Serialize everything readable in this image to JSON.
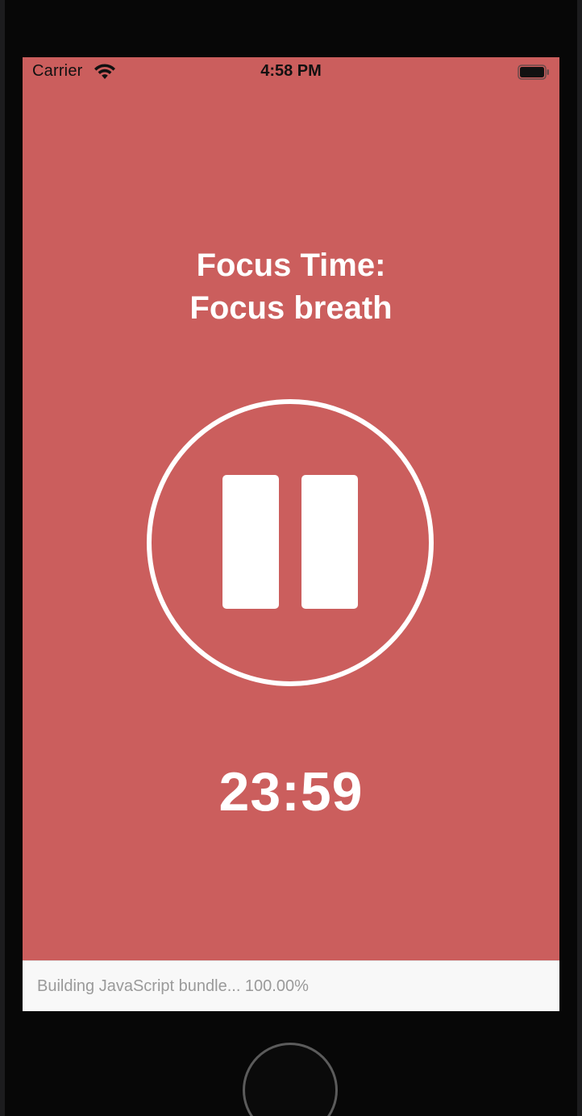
{
  "status_bar": {
    "carrier": "Carrier",
    "time": "4:58 PM",
    "wifi_icon": "wifi-icon",
    "battery_icon": "battery-icon"
  },
  "main": {
    "title_line1": "Focus Time:",
    "title_line2": "Focus breath",
    "pause_icon": "pause-icon",
    "countdown": "23:59"
  },
  "bundle_bar": {
    "text": "Building JavaScript bundle... 100.00%"
  },
  "colors": {
    "background": "#cb5e5d",
    "foreground": "#ffffff",
    "bundle_bar_bg": "#f8f8f8",
    "bundle_text": "#9a9a9a"
  }
}
